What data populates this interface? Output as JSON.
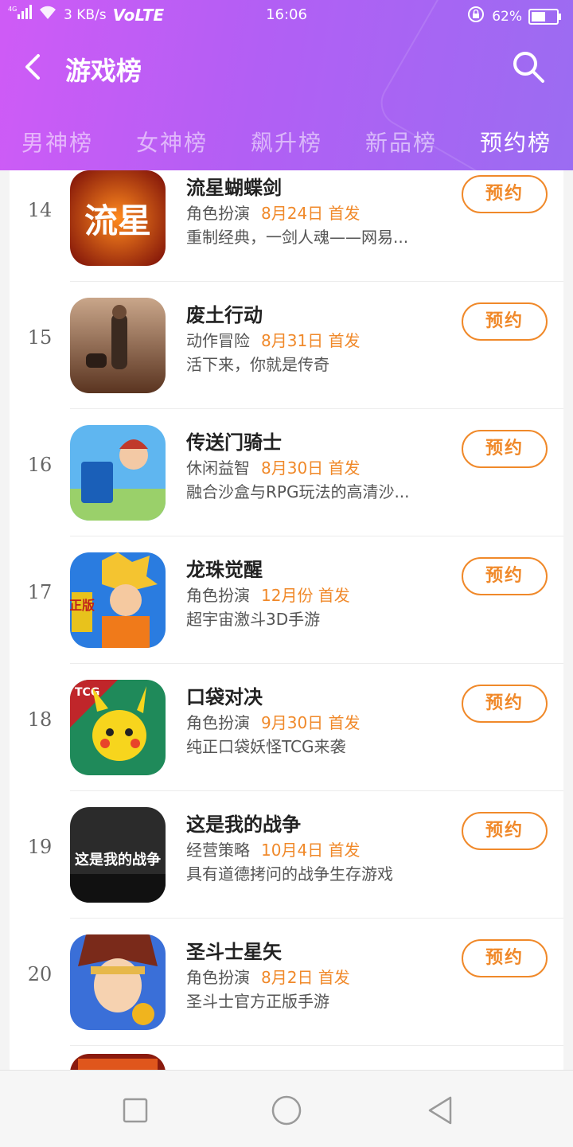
{
  "status_bar": {
    "signal": "4G",
    "speed": "3 KB/s",
    "volte": "VoLTE",
    "time": "16:06",
    "battery": "62%",
    "battery_level": 0.62
  },
  "header": {
    "title": "游戏榜",
    "back_icon": "chevron-left-icon",
    "search_icon": "search-icon"
  },
  "tabs": [
    {
      "label": "男神榜",
      "active": false
    },
    {
      "label": "女神榜",
      "active": false
    },
    {
      "label": "飙升榜",
      "active": false
    },
    {
      "label": "新品榜",
      "active": false
    },
    {
      "label": "预约榜",
      "active": true
    }
  ],
  "accent_color": "#f0892a",
  "games": [
    {
      "rank": "14",
      "name": "流星蝴蝶剑",
      "genre": "角色扮演",
      "date": "8月24日 首发",
      "desc": "重制经典，一剑人魂——网易...",
      "button": "预约",
      "icon_text": "流星"
    },
    {
      "rank": "15",
      "name": "废土行动",
      "genre": "动作冒险",
      "date": "8月31日 首发",
      "desc": "活下来，你就是传奇",
      "button": "预约",
      "icon_text": ""
    },
    {
      "rank": "16",
      "name": "传送门骑士",
      "genre": "休闲益智",
      "date": "8月30日 首发",
      "desc": "融合沙盒与RPG玩法的高清沙...",
      "button": "预约",
      "icon_text": ""
    },
    {
      "rank": "17",
      "name": "龙珠觉醒",
      "genre": "角色扮演",
      "date": "12月份 首发",
      "desc": "超宇宙激斗3D手游",
      "button": "预约",
      "icon_text": "正版"
    },
    {
      "rank": "18",
      "name": "口袋对决",
      "genre": "角色扮演",
      "date": "9月30日 首发",
      "desc": "纯正口袋妖怪TCG来袭",
      "button": "预约",
      "icon_text": "TCG"
    },
    {
      "rank": "19",
      "name": "这是我的战争",
      "genre": "经营策略",
      "date": "10月4日 首发",
      "desc": "具有道德拷问的战争生存游戏",
      "button": "预约",
      "icon_text": "这是我的战争"
    },
    {
      "rank": "20",
      "name": "圣斗士星矢",
      "genre": "角色扮演",
      "date": "8月2日 首发",
      "desc": "圣斗士官方正版手游",
      "button": "预约",
      "icon_text": ""
    }
  ]
}
